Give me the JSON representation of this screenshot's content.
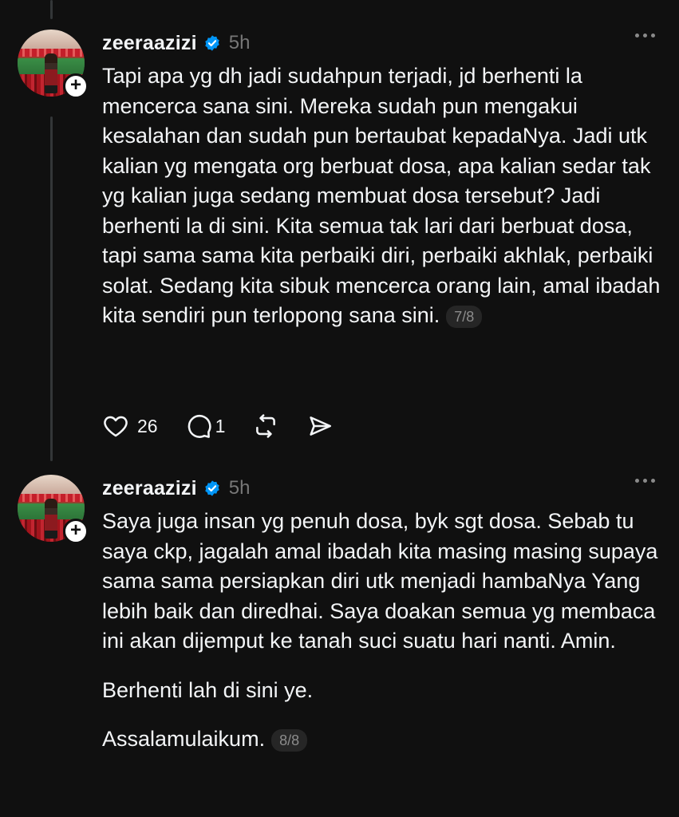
{
  "colors": {
    "background": "#101010",
    "text": "#f3f5f7",
    "muted": "#777777",
    "verified": "#0095f6",
    "thread_line": "#333638"
  },
  "posts": [
    {
      "username": "zeeraazizi",
      "verified_icon": "verified-badge-icon",
      "time": "5h",
      "paragraphs": [
        "Tapi apa yg dh jadi sudahpun terjadi, jd berhenti la mencerca sana sini. Mereka sudah pun mengakui kesalahan dan sudah pun bertaubat kepadaNya. Jadi utk kalian yg mengata org berbuat dosa, apa kalian sedar tak yg kalian juga sedang membuat dosa tersebut? Jadi berhenti la di sini. Kita semua tak lari dari berbuat dosa, tapi sama sama kita perbaiki diri, perbaiki akhlak, perbaiki solat. Sedang kita sibuk mencerca orang lain, amal ibadah kita sendiri pun terlopong sana sini."
      ],
      "counter": "7/8",
      "likes": "26",
      "replies": "1"
    },
    {
      "username": "zeeraazizi",
      "verified_icon": "verified-badge-icon",
      "time": "5h",
      "paragraphs": [
        "Saya juga insan yg penuh dosa, byk sgt dosa. Sebab tu saya ckp, jagalah amal ibadah kita masing masing supaya sama sama persiapkan diri utk menjadi hambaNya Yang lebih baik dan diredhai. Saya doakan semua yg membaca ini akan dijemput ke tanah suci suatu hari nanti. Amin.",
        "Berhenti lah di sini ye.",
        "Assalamulaikum."
      ],
      "counter": "8/8"
    }
  ]
}
